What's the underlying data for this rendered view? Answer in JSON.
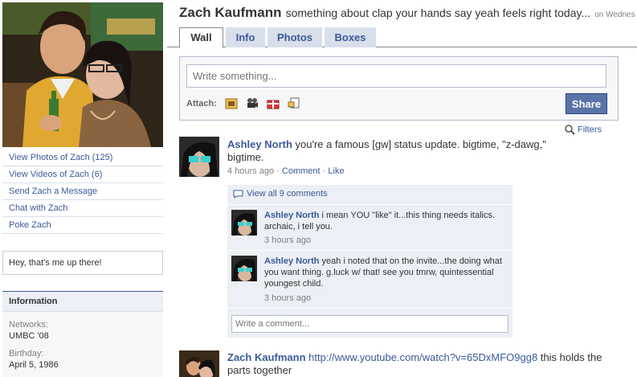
{
  "left": {
    "photo_alt": "profile photo",
    "links": [
      "View Photos of Zach (125)",
      "View Videos of Zach (6)",
      "Send Zach a Message",
      "Chat with Zach",
      "Poke Zach"
    ],
    "caption": "Hey, that's me up there!",
    "info": {
      "header": "Information",
      "networks_label": "Networks:",
      "networks_value": "UMBC '08",
      "birthday_label": "Birthday:",
      "birthday_value": "April 5, 1986"
    }
  },
  "header": {
    "name": "Zach Kaufmann",
    "status": "something about clap your hands say yeah feels right today...",
    "time": "on Wednes"
  },
  "tabs": [
    "Wall",
    "Info",
    "Photos",
    "Boxes"
  ],
  "publisher": {
    "placeholder": "Write something...",
    "attach_label": "Attach:",
    "share_label": "Share",
    "attach_icons": [
      "photo-icon",
      "video-icon",
      "gift-icon",
      "link-icon"
    ]
  },
  "filters_label": "Filters",
  "stories": [
    {
      "actor": "Ashley North",
      "text": "you're a famous [gw] status update. bigtime, \"z-dawg,\" bigtime.",
      "time": "4 hours ago",
      "sep": "·",
      "comment_link": "Comment",
      "like_link": "Like"
    },
    {
      "actor": "Zach Kaufmann",
      "url": "http://www.youtube.com/watch?v=65DxMFO9gg8",
      "text": "this holds the parts together"
    }
  ],
  "comments": {
    "view_all": "View all 9 comments",
    "items": [
      {
        "actor": "Ashley North",
        "text": "i mean YOU \"like\" it...this thing needs italics. archaic, i tell you.",
        "time": "3 hours ago"
      },
      {
        "actor": "Ashley North",
        "text": "yeah i noted that on the invite...the doing what you want thing. g.luck w/ that! see you tmrw, quintessential youngest child.",
        "time": "3 hours ago"
      }
    ],
    "input_placeholder": "Write a comment..."
  },
  "colors": {
    "link": "#3b5998",
    "tab_bg": "#d8dfea",
    "share_button": "#5b74a8",
    "comment_bg": "#eceff5"
  }
}
